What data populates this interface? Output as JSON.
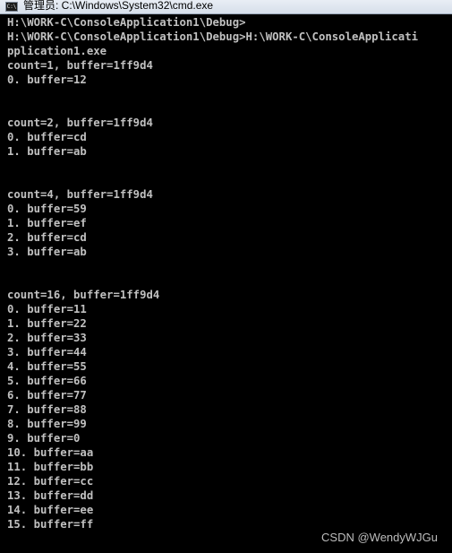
{
  "window": {
    "title": "管理员: C:\\Windows\\System32\\cmd.exe",
    "icon": "cmd-icon",
    "icon_glyph": "C:\\"
  },
  "console": {
    "lines": [
      "H:\\WORK-C\\ConsoleApplication1\\Debug>",
      "H:\\WORK-C\\ConsoleApplication1\\Debug>H:\\WORK-C\\ConsoleApplicati",
      "pplication1.exe",
      "count=1, buffer=1ff9d4",
      "0. buffer=12",
      "",
      "",
      "count=2, buffer=1ff9d4",
      "0. buffer=cd",
      "1. buffer=ab",
      "",
      "",
      "count=4, buffer=1ff9d4",
      "0. buffer=59",
      "1. buffer=ef",
      "2. buffer=cd",
      "3. buffer=ab",
      "",
      "",
      "count=16, buffer=1ff9d4",
      "0. buffer=11",
      "1. buffer=22",
      "2. buffer=33",
      "3. buffer=44",
      "4. buffer=55",
      "5. buffer=66",
      "6. buffer=77",
      "7. buffer=88",
      "8. buffer=99",
      "9. buffer=0",
      "10. buffer=aa",
      "11. buffer=bb",
      "12. buffer=cc",
      "13. buffer=dd",
      "14. buffer=ee",
      "15. buffer=ff"
    ]
  },
  "watermark": "CSDN @WendyWJGu",
  "colors": {
    "console_bg": "#000000",
    "console_text": "#c0c0c0"
  }
}
